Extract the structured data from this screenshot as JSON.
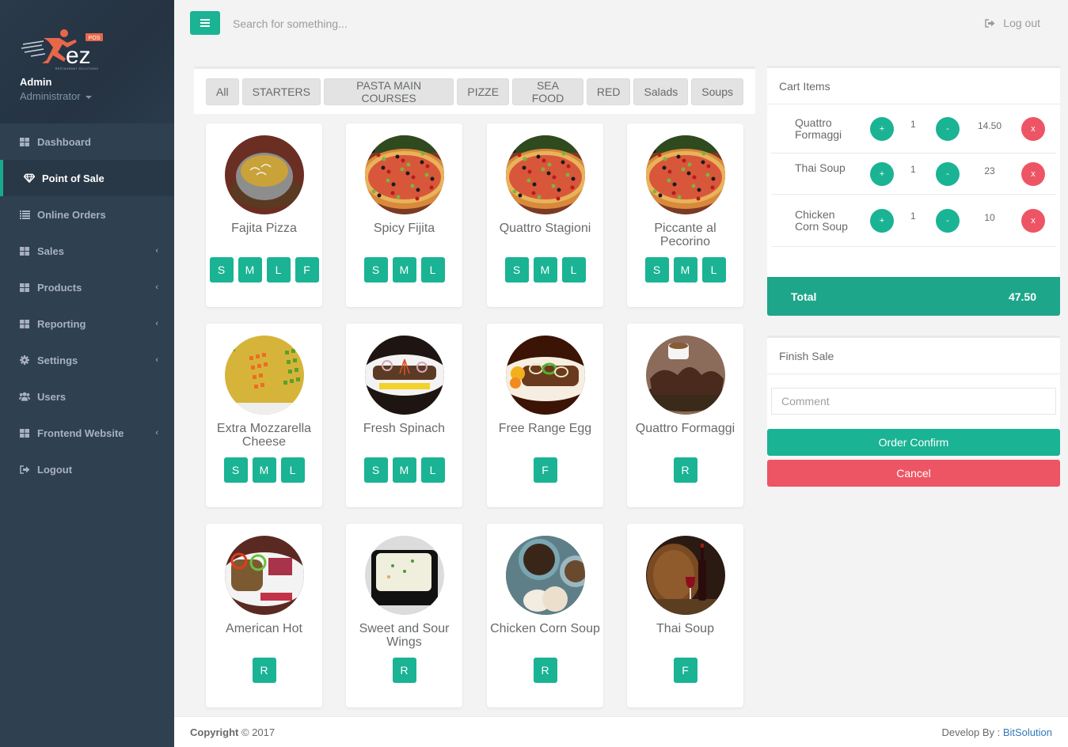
{
  "sidebar": {
    "brand": {
      "logo_text": "ez",
      "logo_badge": "POS",
      "logo_subtitle": "RESTAURANT SOLUTIONS"
    },
    "user": {
      "name": "Admin",
      "role": "Administrator"
    },
    "items": [
      {
        "label": "Dashboard",
        "icon": "th-large-icon",
        "has_submenu": false,
        "active": false
      },
      {
        "label": "Point of Sale",
        "icon": "diamond-icon",
        "has_submenu": false,
        "active": true
      },
      {
        "label": "Online Orders",
        "icon": "list-icon",
        "has_submenu": false,
        "active": false
      },
      {
        "label": "Sales",
        "icon": "th-large-icon",
        "has_submenu": true,
        "active": false
      },
      {
        "label": "Products",
        "icon": "th-large-icon",
        "has_submenu": true,
        "active": false
      },
      {
        "label": "Reporting",
        "icon": "th-large-icon",
        "has_submenu": true,
        "active": false
      },
      {
        "label": "Settings",
        "icon": "gear-icon",
        "has_submenu": true,
        "active": false
      },
      {
        "label": "Users",
        "icon": "users-icon",
        "has_submenu": false,
        "active": false
      },
      {
        "label": "Frontend Website",
        "icon": "th-large-icon",
        "has_submenu": true,
        "active": false
      },
      {
        "label": "Logout",
        "icon": "sign-out-icon",
        "has_submenu": false,
        "active": false
      }
    ],
    "chevron": "‹"
  },
  "topbar": {
    "search_placeholder": "Search for something...",
    "search_value": "",
    "logout_label": "Log out"
  },
  "categories": [
    "All",
    "STARTERS",
    "PASTA MAIN COURSES",
    "PIZZE",
    "SEA FOOD",
    "RED",
    "Salads",
    "Soups"
  ],
  "products": [
    {
      "name": "Fajita Pizza",
      "sizes": [
        "S",
        "M",
        "L",
        "F"
      ],
      "image": "curry-bowl"
    },
    {
      "name": "Spicy Fijita",
      "sizes": [
        "S",
        "M",
        "L"
      ],
      "image": "pizza"
    },
    {
      "name": "Quattro Stagioni",
      "sizes": [
        "S",
        "M",
        "L"
      ],
      "image": "pizza"
    },
    {
      "name": "Piccante al Pecorino",
      "sizes": [
        "S",
        "M",
        "L"
      ],
      "image": "pizza"
    },
    {
      "name": "Extra Mozzarella Cheese",
      "sizes": [
        "S",
        "M",
        "L"
      ],
      "image": "rice"
    },
    {
      "name": "Fresh Spinach",
      "sizes": [
        "S",
        "M",
        "L"
      ],
      "image": "kebab-plate"
    },
    {
      "name": "Free Range Egg",
      "sizes": [
        "F"
      ],
      "image": "kebab-peppers"
    },
    {
      "name": "Quattro Formaggi",
      "sizes": [
        "R"
      ],
      "image": "sizzler"
    },
    {
      "name": "American Hot",
      "sizes": [
        "R"
      ],
      "image": "grilled-plate"
    },
    {
      "name": "Sweet and Sour Wings",
      "sizes": [
        "R"
      ],
      "image": "lasagna"
    },
    {
      "name": "Chicken Corn Soup",
      "sizes": [
        "R"
      ],
      "image": "coffee"
    },
    {
      "name": "Thai Soup",
      "sizes": [
        "F"
      ],
      "image": "wine"
    }
  ],
  "cart": {
    "title": "Cart Items",
    "items": [
      {
        "name": "Quattro Formaggi",
        "qty": "1",
        "price": "14.50"
      },
      {
        "name": "Thai Soup",
        "qty": "1",
        "price": "23"
      },
      {
        "name": "Chicken Corn Soup",
        "qty": "1",
        "price": "10"
      }
    ],
    "plus_label": "+",
    "minus_label": "-",
    "remove_label": "x",
    "total_label": "Total",
    "total_value": "47.50"
  },
  "finish": {
    "title": "Finish Sale",
    "comment_placeholder": "Comment",
    "comment_value": "",
    "confirm_label": "Order Confirm",
    "cancel_label": "Cancel"
  },
  "footer": {
    "copyright_bold": "Copyright",
    "copyright_rest": "© 2017",
    "develop_label": "Develop By :",
    "developer": "BitSolution"
  },
  "colors": {
    "primary": "#1ab394",
    "danger": "#ed5565",
    "sidebar_bg": "#2f4050",
    "total_bg": "#1ea68a",
    "brand_orange": "#e8674a"
  }
}
